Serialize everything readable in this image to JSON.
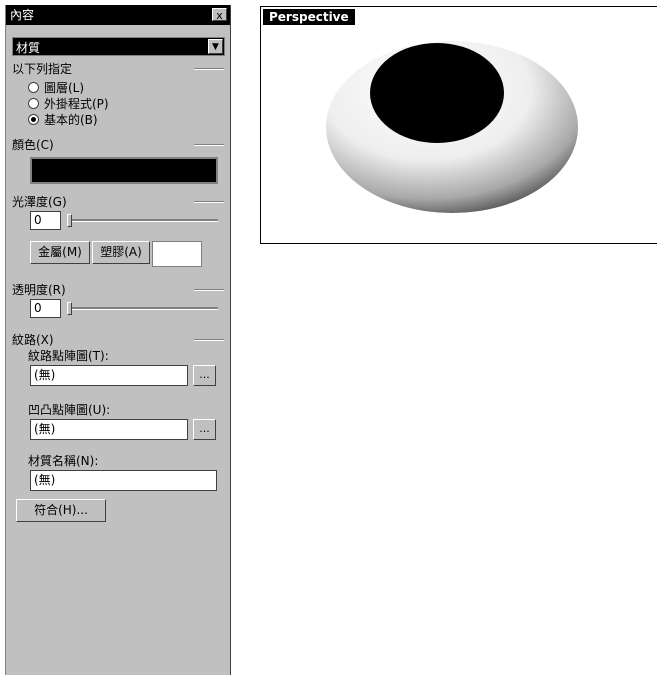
{
  "panel": {
    "title": "內容",
    "close_label": "x",
    "object_type": "材質",
    "assign_section": "以下列指定",
    "radio_options": [
      {
        "label": "圖層(L)",
        "selected": false
      },
      {
        "label": "外掛程式(P)",
        "selected": false
      },
      {
        "label": "基本的(B)",
        "selected": true
      }
    ],
    "color_label": "顏色(C)",
    "color_value": "#000000",
    "gloss_label": "光澤度(G)",
    "gloss_value": "0",
    "metal_button": "金屬(M)",
    "plastic_button": "塑膠(A)",
    "transparency_label": "透明度(R)",
    "transparency_value": "0",
    "texture_label": "紋路(X)",
    "texture_map_label": "紋路點陣圖(T):",
    "texture_map_value": "(無)",
    "bump_map_label": "凹凸點陣圖(U):",
    "bump_map_value": "(無)",
    "material_name_label": "材質名稱(N):",
    "material_name_value": "(無)",
    "browse_label": "...",
    "match_button": "符合(H)..."
  },
  "viewport": {
    "name": "Perspective"
  }
}
